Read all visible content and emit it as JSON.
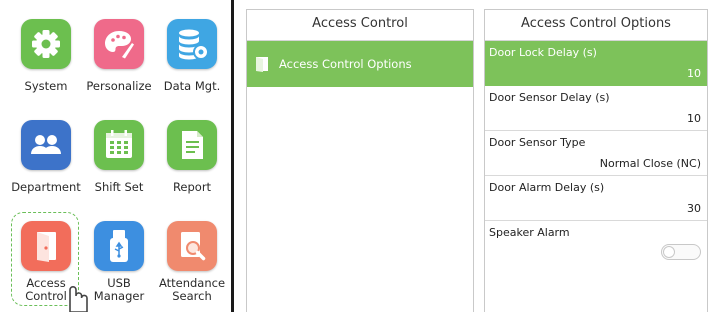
{
  "menu": {
    "tiles": [
      {
        "label": "System",
        "icon": "gear-icon",
        "color": "#6cbf4f"
      },
      {
        "label": "Personalize",
        "icon": "palette-icon",
        "color": "#ef6a8a"
      },
      {
        "label": "Data Mgt.",
        "icon": "database-gear-icon",
        "color": "#3fa6e3"
      },
      {
        "label": "Department",
        "icon": "people-icon",
        "color": "#3d73c9"
      },
      {
        "label": "Shift Set",
        "icon": "calendar-icon",
        "color": "#6cbf4f"
      },
      {
        "label": "Report",
        "icon": "document-icon",
        "color": "#6cbf4f"
      },
      {
        "label": "Access\nControl",
        "icon": "door-icon",
        "color": "#f26d5b"
      },
      {
        "label": "USB\nManager",
        "icon": "usb-icon",
        "color": "#3d8fe0"
      },
      {
        "label": "Attendance\nSearch",
        "icon": "magnifier-icon",
        "color": "#f08a6e"
      }
    ],
    "selected": "Access Control"
  },
  "access_control_panel": {
    "title": "Access Control",
    "items": [
      {
        "label": "Access Control Options",
        "icon": "door-icon"
      }
    ]
  },
  "options_panel": {
    "title": "Access Control Options",
    "options": [
      {
        "label": "Door Lock Delay (s)",
        "value": "10"
      },
      {
        "label": "Door Sensor Delay (s)",
        "value": "10"
      },
      {
        "label": "Door Sensor Type",
        "value": "Normal Close (NC)"
      },
      {
        "label": "Door Alarm Delay (s)",
        "value": "30"
      },
      {
        "label": "Speaker Alarm",
        "value": "off"
      }
    ]
  },
  "colors": {
    "accent_green": "#7dc25a",
    "selection_ring": "#6bbf59"
  }
}
